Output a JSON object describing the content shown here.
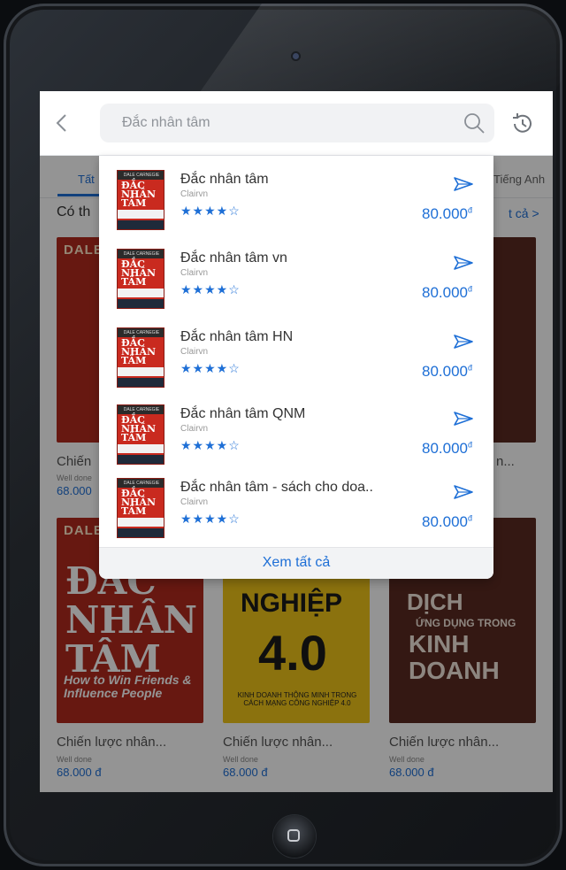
{
  "header": {
    "search_value": "Đắc nhân tâm"
  },
  "background": {
    "tab_left": "Tất",
    "tab_right": "Tiếng Anh",
    "section_title": "Có th",
    "section_more": "t cả >",
    "row1_captions": [
      {
        "title": "Chiến",
        "author": "Well done",
        "price": "68.000"
      },
      {
        "title": "",
        "author": "",
        "price": ""
      },
      {
        "title": "n...",
        "author": "",
        "price": ""
      }
    ],
    "row2_covers": [
      {
        "top": "DALE",
        "big": "ĐẮC NHÂN TÂM",
        "sub": "How to Win Friends & Influence People"
      },
      {
        "top": "",
        "big": "NGHIỆP",
        "num": "4.0",
        "cap": "KINH DOANH THÔNG MINH TRONG CÁCH MẠNG CÔNG NGHIỆP 4.0"
      },
      {
        "top": "",
        "big": "DỊCH",
        "sub": "ỨNG DỤNG TRONG",
        "big2": "KINH DOANH"
      }
    ],
    "row2_captions": [
      {
        "title": "Chiến lược nhân...",
        "author": "Well done",
        "price": "68.000 đ"
      },
      {
        "title": "Chiến lược nhân...",
        "author": "Well done",
        "price": "68.000 đ"
      },
      {
        "title": "Chiến lược nhân...",
        "author": "Well done",
        "price": "68.000 đ"
      }
    ]
  },
  "results": [
    {
      "title": "Đắc nhân tâm",
      "author": "Clairvn",
      "stars": "★★★★☆",
      "price": "80.000",
      "currency": "đ"
    },
    {
      "title": "Đắc nhân tâm vn",
      "author": "Clairvn",
      "stars": "★★★★☆",
      "price": "80.000",
      "currency": "đ"
    },
    {
      "title": "Đắc nhân tâm HN",
      "author": "Clairvn",
      "stars": "★★★★☆",
      "price": "80.000",
      "currency": "đ"
    },
    {
      "title": "Đắc nhân tâm QNM",
      "author": "Clairvn",
      "stars": "★★★★☆",
      "price": "80.000",
      "currency": "đ"
    },
    {
      "title": "Đắc nhân tâm - sách cho doa..",
      "author": "Clairvn",
      "stars": "★★★★☆",
      "price": "80.000",
      "currency": "đ"
    }
  ],
  "cover_text": {
    "brand": "DALE CARNEGIE",
    "title": "ĐẮC NHÂN TÂM"
  },
  "see_all": "Xem tất cả",
  "colors": {
    "accent": "#1e6fd6",
    "cover_red": "#c92a1f"
  }
}
